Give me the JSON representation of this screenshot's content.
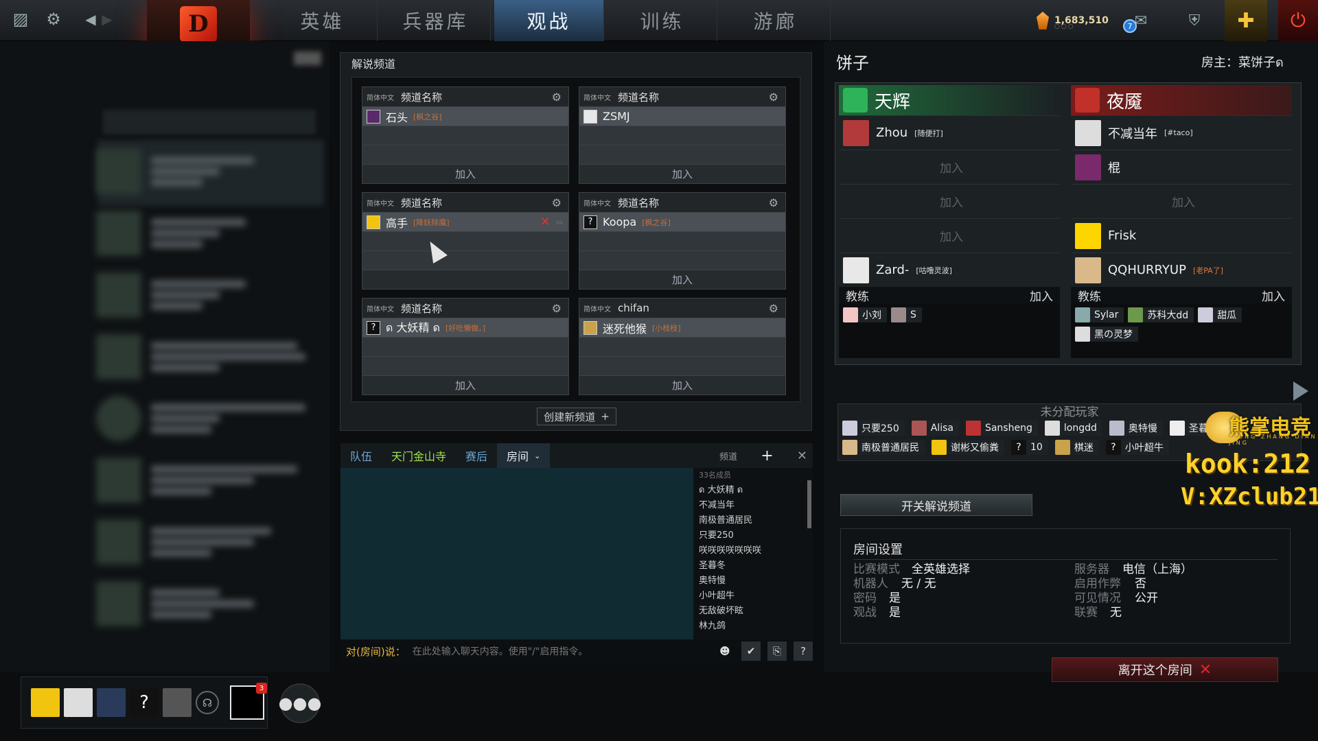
{
  "topbar": {
    "tabs": [
      "英雄",
      "兵器库",
      "观战",
      "训练",
      "游廊"
    ],
    "active_tab": "观战",
    "shards": "1,683,510",
    "mail_count": "7"
  },
  "broadcast": {
    "title": "解说频道",
    "create_label": "创建新频道",
    "channels": [
      {
        "lang": "简体中文",
        "name": "频道名称",
        "player": "石头",
        "tag": "[枫之谷]",
        "join": "加入"
      },
      {
        "lang": "简体中文",
        "name": "频道名称",
        "player": "ZSMJ",
        "tag": "",
        "join": "加入"
      },
      {
        "lang": "简体中文",
        "name": "频道名称",
        "player": "高手",
        "tag": "[降妖除魔]",
        "join": ""
      },
      {
        "lang": "简体中文",
        "name": "频道名称",
        "player": "Koopa",
        "tag": "[枫之谷]",
        "join": "加入"
      },
      {
        "lang": "简体中文",
        "name": "频道名称",
        "player": "ด 大妖精 ด",
        "tag": "[好吃懒做。]",
        "join": "加入"
      },
      {
        "lang": "简体中文",
        "name": "chifan",
        "player": "迷死他猴",
        "tag": "[小枝枝]",
        "join": "加入"
      }
    ]
  },
  "chat": {
    "tabs": [
      "队伍",
      "天门金山寺",
      "赛后",
      "房间"
    ],
    "active_tab": "房间",
    "channel_label": "频道",
    "member_count": "33名成员",
    "members": [
      "ด 大妖精 ด",
      "不减当年",
      "南极普通居民",
      "只要250",
      "咲咲咲咲咲咲咲",
      "圣暮冬",
      "奥特慢",
      "小叶超牛",
      "无敌破坏眩",
      "林九鸽"
    ],
    "input_prefix": "对(房间)说：",
    "input_placeholder": "在此处输入聊天内容。使用\"/\"启用指令。"
  },
  "lobby": {
    "name": "饼子",
    "host": "房主：菜饼子ด",
    "radiant": {
      "name": "天辉",
      "slots": [
        {
          "name": "Zhou",
          "tag": "[随便打]"
        },
        {
          "name": "",
          "tag": "",
          "join": "加入"
        },
        {
          "name": "",
          "tag": "",
          "join": "加入"
        },
        {
          "name": "",
          "tag": "",
          "join": "加入"
        },
        {
          "name": "Zard-",
          "tag": "[咕噜灵波]"
        }
      ],
      "coach_label": "教练",
      "coach_join": "加入",
      "coaches": [
        "小刘",
        "S"
      ]
    },
    "dire": {
      "name": "夜魇",
      "slots": [
        {
          "name": "不减当年",
          "tag": "[#taco]"
        },
        {
          "name": "棍",
          "tag": ""
        },
        {
          "name": "",
          "tag": "",
          "join": "加入"
        },
        {
          "name": "Frisk",
          "tag": ""
        },
        {
          "name": "QQHURRYUP",
          "tag": "[老PA了]"
        }
      ],
      "coach_label": "教练",
      "coach_join": "加入",
      "coaches": [
        "Sylar",
        "苏科大dd",
        "甜瓜",
        "黑の灵梦"
      ]
    },
    "unassigned_title": "未分配玩家",
    "unassigned": [
      "只要250",
      "Alisa",
      "Sansheng",
      "longdd",
      "奥特慢",
      "圣暮冬",
      "南极普通居民",
      "谢彬又偷粪",
      "10",
      "棋迷",
      "小叶超牛"
    ],
    "toggle_broadcast": "开关解说频道",
    "settings": {
      "title": "房间设置",
      "left": [
        {
          "k": "比赛模式",
          "v": "全英雄选择"
        },
        {
          "k": "机器人",
          "v": "无 / 无"
        },
        {
          "k": "密码",
          "v": "是"
        },
        {
          "k": "观战",
          "v": "是"
        }
      ],
      "right": [
        {
          "k": "服务器",
          "v": "电信（上海）"
        },
        {
          "k": "启用作弊",
          "v": "否"
        },
        {
          "k": "可见情况",
          "v": "公开"
        },
        {
          "k": "联赛",
          "v": "无"
        }
      ]
    },
    "leave_label": "离开这个房间"
  },
  "watermark": {
    "name": "熊掌电竞",
    "sub": "XIONG ZHANG DIAN JING",
    "kook": "kook:212",
    "v": "V:XZclub212"
  },
  "party": {
    "invite_badge": "3"
  }
}
